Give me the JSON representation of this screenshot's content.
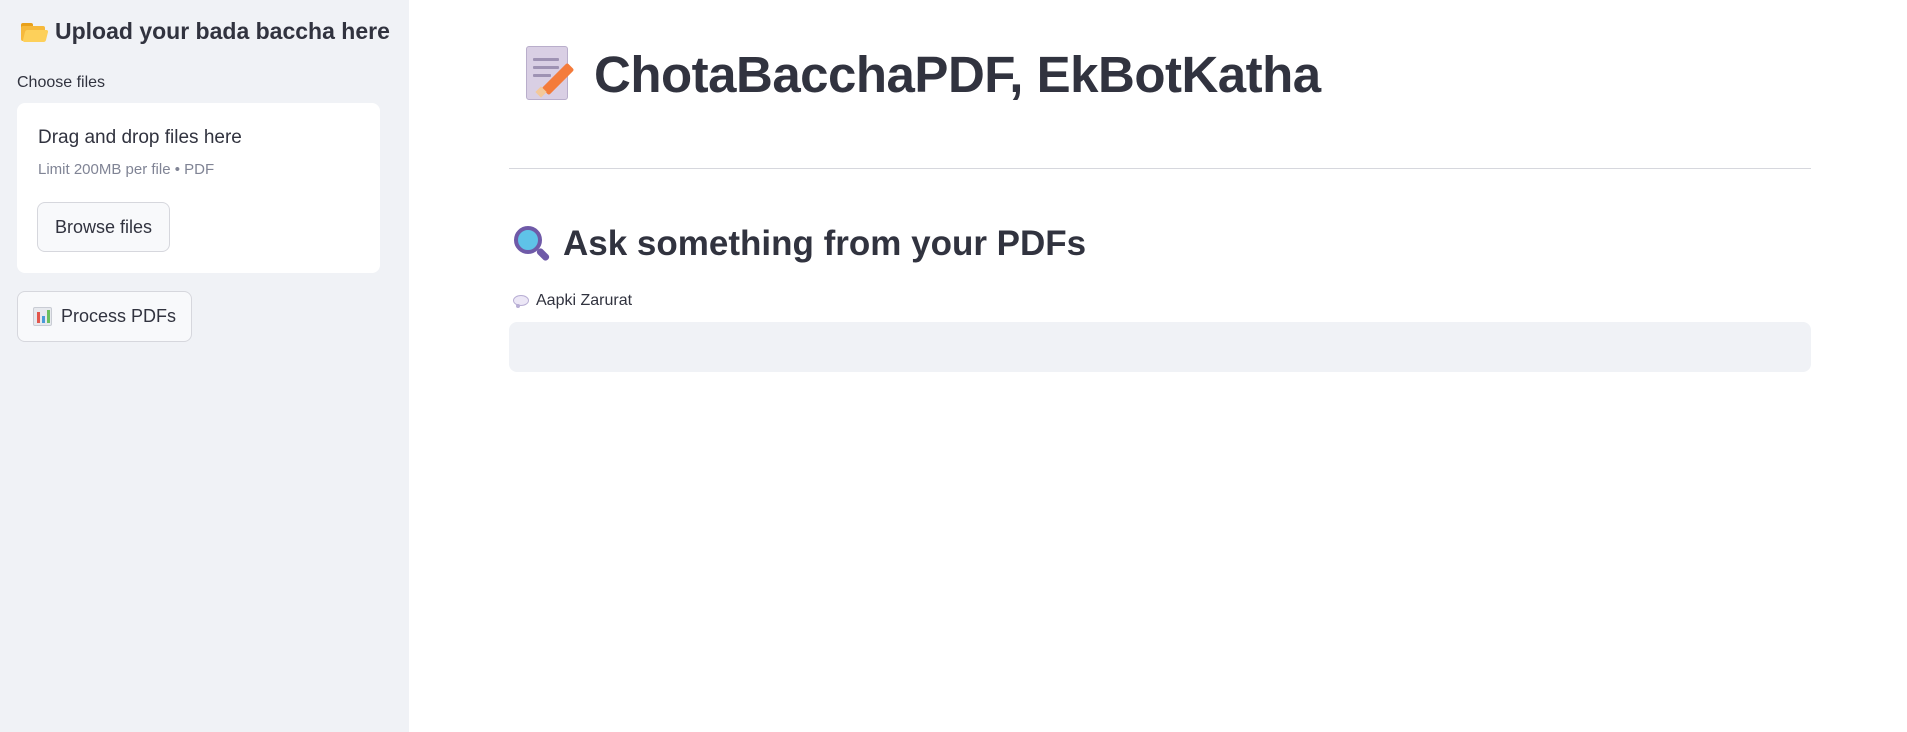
{
  "sidebar": {
    "heading": "Upload your bada baccha here",
    "heading_icon": "folder-icon",
    "uploader": {
      "label": "Choose files",
      "dropzone_title": "Drag and drop files here",
      "dropzone_subtitle": "Limit 200MB per file • PDF",
      "browse_label": "Browse files"
    },
    "process_button": {
      "label": "Process PDFs",
      "icon": "bar-chart-icon"
    }
  },
  "main": {
    "title": "ChotaBacchaPDF, EkBotKatha",
    "title_icon": "memo-icon",
    "section_heading": "Ask something from your PDFs",
    "section_icon": "magnifier-icon",
    "input": {
      "label": "Aapki Zarurat",
      "label_icon": "speech-bubble-icon",
      "value": "",
      "placeholder": ""
    }
  },
  "colors": {
    "sidebar_bg": "#f0f2f6",
    "text": "#31333f",
    "muted_text": "#808495",
    "input_bg": "#f0f2f6",
    "divider": "#d6d7dd"
  }
}
